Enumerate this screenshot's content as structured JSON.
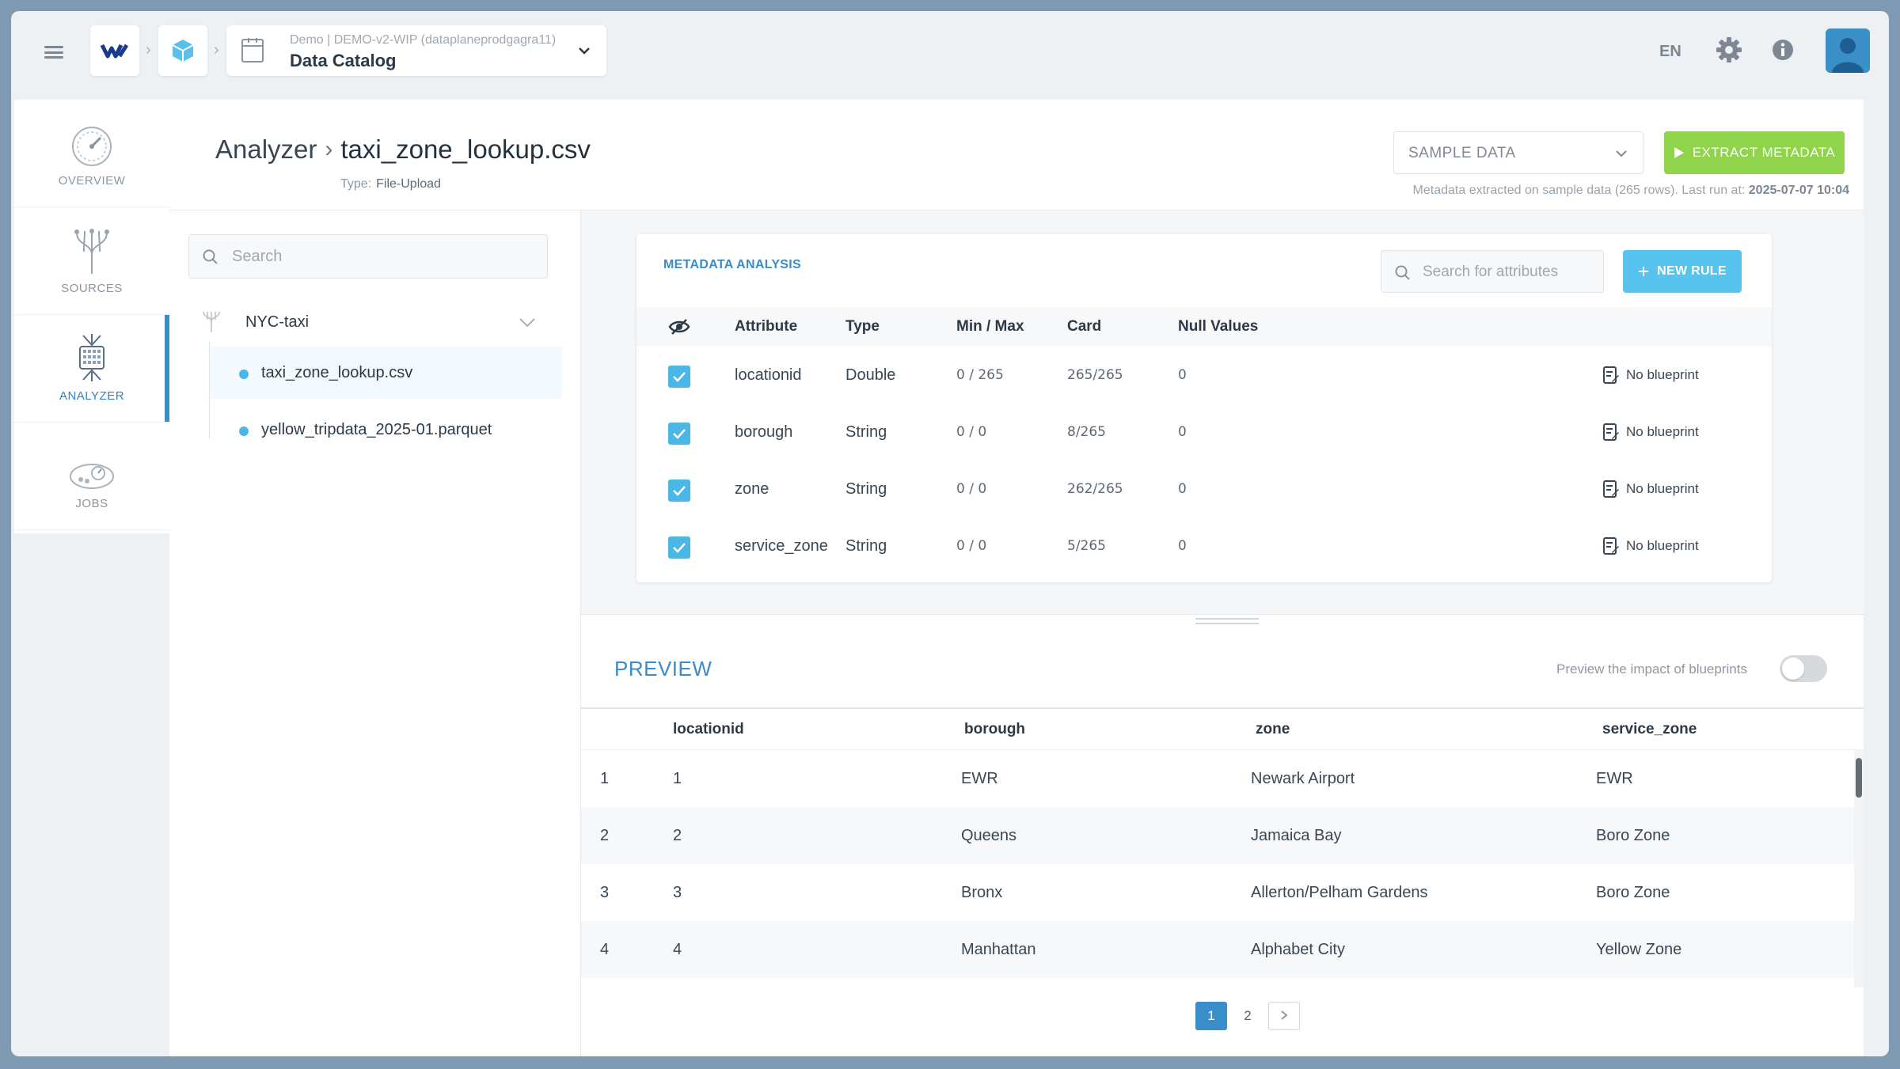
{
  "topbar": {
    "dataset_sub": "Demo | DEMO-v2-WIP (dataplaneprodgagra11)",
    "dataset_title": "Data Catalog",
    "lang": "EN"
  },
  "nav": {
    "items": [
      {
        "label": "OVERVIEW"
      },
      {
        "label": "SOURCES"
      },
      {
        "label": "ANALYZER"
      },
      {
        "label": "JOBS"
      }
    ]
  },
  "header": {
    "crumb_root": "Analyzer",
    "crumb_current": "taxi_zone_lookup.csv",
    "type_label": "Type:",
    "type_value": "File-Upload",
    "sample_select": "SAMPLE DATA",
    "extract_button": "EXTRACT METADATA",
    "meta_note": "Metadata extracted on sample data (265 rows).  Last run at:",
    "meta_time": "2025-07-07 10:04"
  },
  "tree": {
    "search_placeholder": "Search",
    "folder": "NYC-taxi",
    "files": [
      "taxi_zone_lookup.csv",
      "yellow_tripdata_2025-01.parquet"
    ]
  },
  "metadata": {
    "title": "METADATA ANALYSIS",
    "search_placeholder": "Search for attributes",
    "new_rule": "NEW RULE",
    "headers": {
      "attribute": "Attribute",
      "type": "Type",
      "minmax": "Min / Max",
      "card": "Card",
      "nulls": "Null Values"
    },
    "rows": [
      {
        "attribute": "locationid",
        "type": "Double",
        "minmax": "0 / 265",
        "card": "265/265",
        "nulls": "0",
        "blueprint": "No blueprint",
        "checked": true
      },
      {
        "attribute": "borough",
        "type": "String",
        "minmax": "0 / 0",
        "card": "8/265",
        "nulls": "0",
        "blueprint": "No blueprint",
        "checked": true
      },
      {
        "attribute": "zone",
        "type": "String",
        "minmax": "0 / 0",
        "card": "262/265",
        "nulls": "0",
        "blueprint": "No blueprint",
        "checked": true
      },
      {
        "attribute": "service_zone",
        "type": "String",
        "minmax": "0 / 0",
        "card": "5/265",
        "nulls": "0",
        "blueprint": "No blueprint",
        "checked": true
      }
    ]
  },
  "preview": {
    "title": "PREVIEW",
    "toggle_label": "Preview the impact of blueprints",
    "columns": [
      "locationid",
      "borough",
      "zone",
      "service_zone"
    ],
    "rows": [
      [
        "1",
        "1",
        "EWR",
        "Newark Airport",
        "EWR"
      ],
      [
        "2",
        "2",
        "Queens",
        "Jamaica Bay",
        "Boro Zone"
      ],
      [
        "3",
        "3",
        "Bronx",
        "Allerton/Pelham Gardens",
        "Boro Zone"
      ],
      [
        "4",
        "4",
        "Manhattan",
        "Alphabet City",
        "Yellow Zone"
      ]
    ],
    "pages": [
      "1",
      "2"
    ],
    "current_page": "1"
  },
  "colors": {
    "accent": "#3a8fcb",
    "extract": "#8fd44a",
    "new_rule": "#59c3ef",
    "checkbox": "#4bb7e8"
  }
}
